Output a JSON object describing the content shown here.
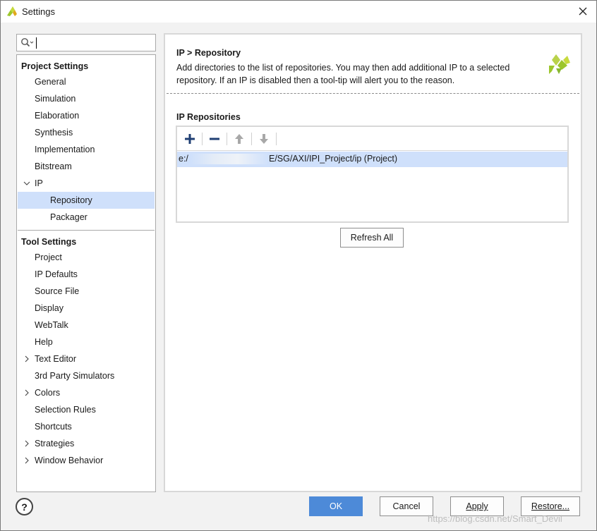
{
  "window": {
    "title": "Settings"
  },
  "search": {
    "value": "",
    "icon": "search-icon"
  },
  "sidebar": {
    "project_header": "Project Settings",
    "project_items": [
      {
        "label": "General",
        "expandable": false,
        "selected": false,
        "level": 1
      },
      {
        "label": "Simulation",
        "expandable": false,
        "selected": false,
        "level": 1
      },
      {
        "label": "Elaboration",
        "expandable": false,
        "selected": false,
        "level": 1
      },
      {
        "label": "Synthesis",
        "expandable": false,
        "selected": false,
        "level": 1
      },
      {
        "label": "Implementation",
        "expandable": false,
        "selected": false,
        "level": 1
      },
      {
        "label": "Bitstream",
        "expandable": false,
        "selected": false,
        "level": 1
      },
      {
        "label": "IP",
        "expandable": true,
        "expanded": true,
        "selected": false,
        "level": 1
      },
      {
        "label": "Repository",
        "expandable": false,
        "selected": true,
        "level": 2
      },
      {
        "label": "Packager",
        "expandable": false,
        "selected": false,
        "level": 2
      }
    ],
    "tool_header": "Tool Settings",
    "tool_items": [
      {
        "label": "Project",
        "expandable": false
      },
      {
        "label": "IP Defaults",
        "expandable": false
      },
      {
        "label": "Source File",
        "expandable": false
      },
      {
        "label": "Display",
        "expandable": false
      },
      {
        "label": "WebTalk",
        "expandable": false
      },
      {
        "label": "Help",
        "expandable": false
      },
      {
        "label": "Text Editor",
        "expandable": true,
        "expanded": false
      },
      {
        "label": "3rd Party Simulators",
        "expandable": false
      },
      {
        "label": "Colors",
        "expandable": true,
        "expanded": false
      },
      {
        "label": "Selection Rules",
        "expandable": false
      },
      {
        "label": "Shortcuts",
        "expandable": false
      },
      {
        "label": "Strategies",
        "expandable": true,
        "expanded": false
      },
      {
        "label": "Window Behavior",
        "expandable": true,
        "expanded": false
      }
    ]
  },
  "content": {
    "breadcrumb": "IP > Repository",
    "description": "Add directories to the list of repositories. You may then add additional IP to a selected repository. If an IP is disabled then a tool-tip will alert you to the reason.",
    "section_title": "IP Repositories",
    "toolbar": {
      "add_icon": "plus-icon",
      "remove_icon": "minus-icon",
      "up_icon": "arrow-up-icon",
      "down_icon": "arrow-down-icon"
    },
    "repositories": [
      {
        "path_start": "e:/",
        "path_end": "E/SG/AXI/IPI_Project/ip (Project)",
        "selected": true
      }
    ],
    "refresh_label": "Refresh All"
  },
  "footer": {
    "help_label": "?",
    "ok_label": "OK",
    "cancel_label": "Cancel",
    "apply_label": "Apply",
    "restore_label": "Restore..."
  },
  "watermark": "https://blog.csdn.net/Smart_Devil",
  "colors": {
    "accent": "#4d8ad8",
    "selection": "#cfe0fb",
    "logo": "#9cc62c"
  }
}
